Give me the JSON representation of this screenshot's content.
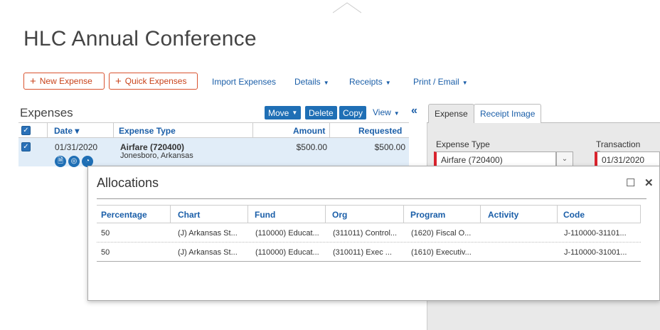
{
  "report": {
    "title": "HLC Annual Conference"
  },
  "toolbar": {
    "new_expense": "New Expense",
    "quick_expenses": "Quick Expenses",
    "import_expenses": "Import Expenses",
    "details": "Details",
    "receipts": "Receipts",
    "print_email": "Print / Email"
  },
  "expenses": {
    "title": "Expenses",
    "move": "Move",
    "delete": "Delete",
    "copy": "Copy",
    "view": "View",
    "collapse_icon": "«",
    "columns": {
      "date": "Date ▾",
      "expense_type": "Expense Type",
      "amount": "Amount",
      "requested": "Requested"
    },
    "rows": [
      {
        "date": "01/31/2020",
        "type": "Airfare (720400)",
        "location": "Jonesboro, Arkansas",
        "amount": "$500.00",
        "requested": "$500.00"
      }
    ]
  },
  "panel": {
    "tabs": [
      "Expense",
      "Receipt Image"
    ],
    "expense_type_label": "Expense Type",
    "expense_type_value": "Airfare (720400)",
    "transaction_date_label": "Transaction Date",
    "transaction_date_value": "01/31/2020"
  },
  "allocations": {
    "title": "Allocations",
    "columns": [
      "Percentage",
      "Chart",
      "Fund",
      "Org",
      "Program",
      "Activity",
      "Code"
    ],
    "rows": [
      {
        "percentage": "50",
        "chart": "(J) Arkansas St...",
        "fund": "(110000) Educat...",
        "org": "(311011) Control...",
        "program": "(1620) Fiscal O...",
        "activity": "",
        "code": "J-110000-31101..."
      },
      {
        "percentage": "50",
        "chart": "(J) Arkansas St...",
        "fund": "(110000) Educat...",
        "org": "(310011) Exec ...",
        "program": "(1610) Executiv...",
        "activity": "",
        "code": "J-110000-31001..."
      }
    ]
  },
  "colors": {
    "accent_blue": "#1f6fb5",
    "orange": "#d9532f",
    "required_red": "#d9232d"
  }
}
